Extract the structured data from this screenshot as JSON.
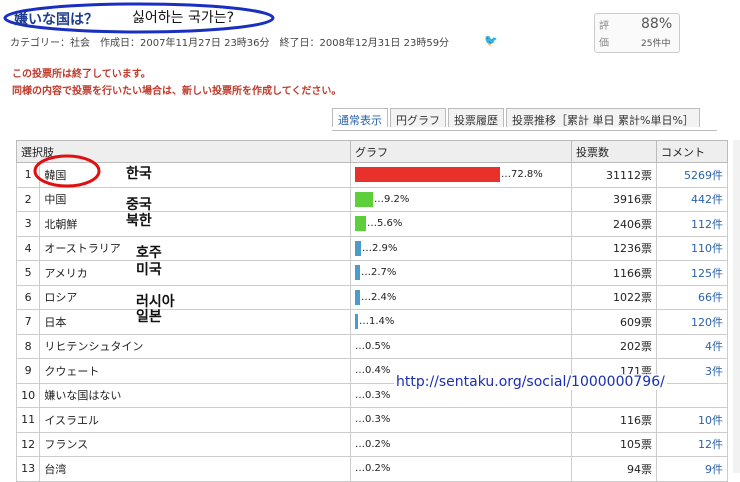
{
  "header": {
    "title": "嫌いな国は？",
    "korean_title": "싫어하는 국가는?",
    "meta": "カテゴリー：社会　作成日：2007年11月27日 23時36分　終了日：2008年12月31日 23時59分"
  },
  "rating": {
    "label1": "評",
    "label2": "価",
    "score": "88%",
    "count": "25件中"
  },
  "notices": [
    "この投票所は終了しています。",
    "同様の内容で投票を行いたい場合は、新しい投票所を作成してください。"
  ],
  "tabs": [
    "通常表示",
    "円グラフ",
    "投票履歴",
    "投票推移［累計 単日 累計%単日%］"
  ],
  "table": {
    "headers": [
      "選択肢",
      "グラフ",
      "投票数",
      "コメント"
    ],
    "rows": [
      {
        "n": "1",
        "name": "韓国",
        "pct": "…72.8%",
        "share": 72.8,
        "votes": "31112票",
        "comments": "5269件",
        "color": "#e8312a"
      },
      {
        "n": "2",
        "name": "中国",
        "pct": "…9.2%",
        "share": 9.2,
        "votes": "3916票",
        "comments": "442件",
        "color": "#5ccf3a"
      },
      {
        "n": "3",
        "name": "北朝鮮",
        "pct": "…5.6%",
        "share": 5.6,
        "votes": "2406票",
        "comments": "112件",
        "color": "#5ccf3a"
      },
      {
        "n": "4",
        "name": "オーストラリア",
        "pct": "…2.9%",
        "share": 2.9,
        "votes": "1236票",
        "comments": "110件",
        "color": "#4b9ccd"
      },
      {
        "n": "5",
        "name": "アメリカ",
        "pct": "…2.7%",
        "share": 2.7,
        "votes": "1166票",
        "comments": "125件",
        "color": "#4b9ccd"
      },
      {
        "n": "6",
        "name": "ロシア",
        "pct": "…2.4%",
        "share": 2.4,
        "votes": "1022票",
        "comments": "66件",
        "color": "#4b9ccd"
      },
      {
        "n": "7",
        "name": "日本",
        "pct": "…1.4%",
        "share": 1.4,
        "votes": "609票",
        "comments": "120件",
        "color": "#4b9ccd"
      },
      {
        "n": "8",
        "name": "リヒテンシュタイン",
        "pct": "…0.5%",
        "share": 0.5,
        "votes": "202票",
        "comments": "4件",
        "color": "#4b9ccd"
      },
      {
        "n": "9",
        "name": "クウェート",
        "pct": "…0.4%",
        "share": 0.4,
        "votes": "171票",
        "comments": "3件",
        "color": "#4b9ccd"
      },
      {
        "n": "10",
        "name": "嫌いな国はない",
        "pct": "…0.3%",
        "share": 0.3,
        "votes": "",
        "comments": "",
        "color": "#4b9ccd"
      },
      {
        "n": "11",
        "name": "イスラエル",
        "pct": "…0.3%",
        "share": 0.3,
        "votes": "116票",
        "comments": "10件",
        "color": "#4b9ccd"
      },
      {
        "n": "12",
        "name": "フランス",
        "pct": "…0.2%",
        "share": 0.2,
        "votes": "105票",
        "comments": "12件",
        "color": "#4b9ccd"
      },
      {
        "n": "13",
        "name": "台湾",
        "pct": "…0.2%",
        "share": 0.2,
        "votes": "94票",
        "comments": "9件",
        "color": "#4b9ccd"
      }
    ]
  },
  "annotations": {
    "korean_labels": [
      "한국",
      "중국",
      "북한",
      "호주",
      "미국",
      "러시아",
      "일본"
    ],
    "url": "http://sentaku.org/social/1000000796/"
  },
  "colors": {
    "title_oval": "#1a2fc0",
    "highlight_oval": "#e01010",
    "notice": "#c0392b",
    "link": "#2a62a8"
  }
}
